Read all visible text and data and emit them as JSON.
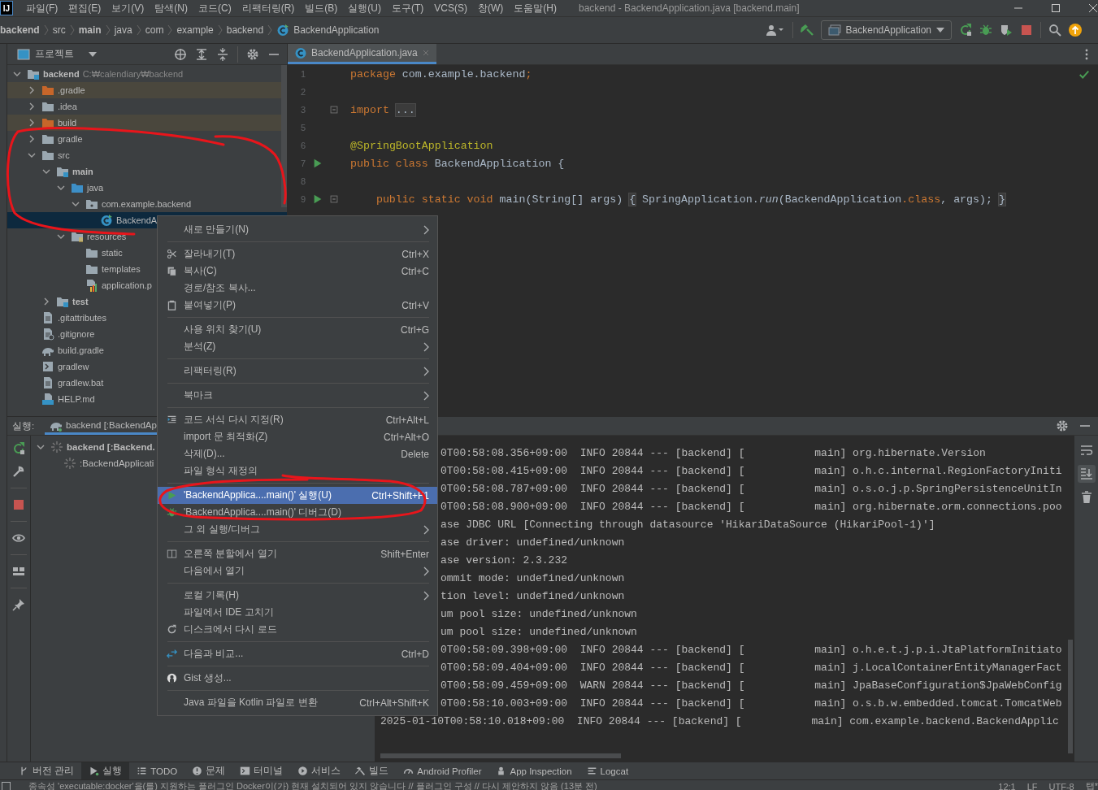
{
  "menu_bar": {
    "logo": "IJ",
    "items": [
      "파일(F)",
      "편집(E)",
      "보기(V)",
      "탐색(N)",
      "코드(C)",
      "리팩터링(R)",
      "빌드(B)",
      "실행(U)",
      "도구(T)",
      "VCS(S)",
      "창(W)",
      "도움말(H)"
    ],
    "title": "backend - BackendApplication.java [backend.main]"
  },
  "breadcrumbs": [
    {
      "label": "backend",
      "kind": "module"
    },
    {
      "label": "src",
      "kind": "folder"
    },
    {
      "label": "main",
      "kind": "module"
    },
    {
      "label": "java",
      "kind": "folder"
    },
    {
      "label": "com",
      "kind": "folder"
    },
    {
      "label": "example",
      "kind": "folder"
    },
    {
      "label": "backend",
      "kind": "folder"
    },
    {
      "label": "BackendApplication",
      "kind": "class"
    }
  ],
  "toolbar": {
    "run_config": "BackendApplication"
  },
  "project_panel": {
    "title": "프로젝트",
    "tree": [
      {
        "label": "backend",
        "kind": "module",
        "hint": "C:₩calendiary₩backend",
        "expanded": true,
        "selected": false,
        "children": [
          {
            "label": ".gradle",
            "kind": "excluded",
            "expanded": false,
            "selected": false
          },
          {
            "label": ".idea",
            "kind": "folder",
            "expanded": false,
            "selected": false
          },
          {
            "label": "build",
            "kind": "excluded",
            "expanded": false,
            "selected": false
          },
          {
            "label": "gradle",
            "kind": "folder",
            "expanded": false,
            "selected": false
          },
          {
            "label": "src",
            "kind": "folder",
            "expanded": true,
            "selected": false,
            "children": [
              {
                "label": "main",
                "kind": "module",
                "expanded": true,
                "selected": false,
                "children": [
                  {
                    "label": "java",
                    "kind": "source",
                    "expanded": true,
                    "selected": false,
                    "children": [
                      {
                        "label": "com.example.backend",
                        "kind": "package",
                        "expanded": true,
                        "selected": false,
                        "children": [
                          {
                            "label": "BackendA",
                            "kind": "class",
                            "selected": true
                          }
                        ]
                      }
                    ]
                  },
                  {
                    "label": "resources",
                    "kind": "resources",
                    "expanded": true,
                    "selected": false,
                    "children": [
                      {
                        "label": "static",
                        "kind": "folder",
                        "selected": false
                      },
                      {
                        "label": "templates",
                        "kind": "folder",
                        "selected": false
                      },
                      {
                        "label": "application.p",
                        "kind": "properties",
                        "selected": false
                      }
                    ]
                  }
                ]
              },
              {
                "label": "test",
                "kind": "module",
                "expanded": false,
                "selected": false
              }
            ]
          },
          {
            "label": ".gitattributes",
            "kind": "text",
            "selected": false
          },
          {
            "label": ".gitignore",
            "kind": "gitignore",
            "selected": false
          },
          {
            "label": "build.gradle",
            "kind": "gradle",
            "selected": false
          },
          {
            "label": "gradlew",
            "kind": "script",
            "selected": false
          },
          {
            "label": "gradlew.bat",
            "kind": "text",
            "selected": false
          },
          {
            "label": "HELP.md",
            "kind": "markdown",
            "selected": false
          }
        ]
      }
    ]
  },
  "editor": {
    "tabs": [
      {
        "label": "BackendApplication.java",
        "selected": true
      }
    ],
    "lines": [
      {
        "number": "1",
        "kind": "top",
        "run_marker": false,
        "fold_marker": false,
        "tokens": [
          {
            "kind": "keyword",
            "text": "package"
          },
          {
            "kind": "plain",
            "text": " com.example.backend"
          },
          {
            "kind": "keyword",
            "text": ";"
          }
        ]
      },
      {
        "number": "2",
        "run_marker": false,
        "fold_marker": false
      },
      {
        "number": "3",
        "kind": "top",
        "run_marker": false,
        "fold_marker": true,
        "tokens": [
          {
            "kind": "keyword",
            "text": "import"
          },
          {
            "kind": "folded",
            "text": "..."
          }
        ]
      },
      {
        "number": "5",
        "run_marker": false,
        "fold_marker": false
      },
      {
        "number": "6",
        "kind": "top",
        "run_marker": false,
        "fold_marker": false,
        "tokens": [
          {
            "kind": "annotation",
            "text": "@SpringBootApplication"
          }
        ]
      },
      {
        "number": "7",
        "kind": "top",
        "run_marker": true,
        "fold_marker": false,
        "tokens": [
          {
            "kind": "keyword",
            "text": "public class"
          },
          {
            "kind": "plain",
            "text": " BackendApplication {"
          }
        ]
      },
      {
        "number": "8",
        "run_marker": false,
        "fold_marker": false
      },
      {
        "number": "9",
        "kind": "member",
        "run_marker": true,
        "fold_marker": true,
        "tokens": [
          {
            "kind": "keyword",
            "text": "public static void"
          },
          {
            "kind": "plain",
            "text": " main(String[] args) "
          },
          {
            "kind": "folded",
            "text": "{"
          },
          {
            "kind": "plain",
            "text": " SpringApplication."
          },
          {
            "kind": "italic",
            "text": "run"
          },
          {
            "kind": "plain",
            "text": "(BackendApplication"
          },
          {
            "kind": "keyword",
            "text": ".class"
          },
          {
            "kind": "plain",
            "text": ", args); "
          },
          {
            "kind": "folded",
            "text": "}"
          }
        ]
      }
    ]
  },
  "context_menu": {
    "items": [
      {
        "kind": "plain",
        "label": "새로 만들기(N)",
        "submenu": true,
        "selected": false
      },
      {
        "kind": "separator"
      },
      {
        "kind": "cut",
        "label": "잘라내기(T)",
        "shortcut": "Ctrl+X",
        "submenu": false,
        "selected": false
      },
      {
        "kind": "copy",
        "label": "복사(C)",
        "shortcut": "Ctrl+C",
        "submenu": false,
        "selected": false
      },
      {
        "kind": "plain",
        "label": "경로/참조 복사...",
        "submenu": false,
        "selected": false
      },
      {
        "kind": "paste",
        "label": "붙여넣기(P)",
        "shortcut": "Ctrl+V",
        "submenu": false,
        "selected": false
      },
      {
        "kind": "separator"
      },
      {
        "kind": "plain",
        "label": "사용 위치 찾기(U)",
        "shortcut": "Ctrl+G",
        "submenu": false,
        "selected": false
      },
      {
        "kind": "plain",
        "label": "분석(Z)",
        "submenu": true,
        "selected": false
      },
      {
        "kind": "separator"
      },
      {
        "kind": "plain",
        "label": "리팩터링(R)",
        "submenu": true,
        "selected": false
      },
      {
        "kind": "separator"
      },
      {
        "kind": "plain",
        "label": "북마크",
        "submenu": true,
        "selected": false
      },
      {
        "kind": "separator"
      },
      {
        "kind": "format",
        "label": "코드 서식 다시 지정(R)",
        "shortcut": "Ctrl+Alt+L",
        "submenu": false,
        "selected": false
      },
      {
        "kind": "plain",
        "label": "import 문 최적화(Z)",
        "shortcut": "Ctrl+Alt+O",
        "submenu": false,
        "selected": false
      },
      {
        "kind": "plain",
        "label": "삭제(D)...",
        "shortcut": "Delete",
        "submenu": false,
        "selected": false
      },
      {
        "kind": "plain",
        "label": "파일 형식 재정의",
        "submenu": false,
        "selected": false
      },
      {
        "kind": "separator"
      },
      {
        "kind": "run",
        "label": "'BackendApplica....main()' 실행(U)",
        "shortcut": "Ctrl+Shift+F1",
        "submenu": false,
        "selected": true
      },
      {
        "kind": "debug",
        "label": "'BackendApplica....main()' 디버그(D)",
        "submenu": false,
        "selected": false
      },
      {
        "kind": "plain",
        "label": "그 외 실행/디버그",
        "submenu": true,
        "selected": false
      },
      {
        "kind": "separator"
      },
      {
        "kind": "split",
        "label": "오른쪽 분할에서 열기",
        "shortcut": "Shift+Enter",
        "submenu": false,
        "selected": false
      },
      {
        "kind": "plain",
        "label": "다음에서 열기",
        "submenu": true,
        "selected": false
      },
      {
        "kind": "separator"
      },
      {
        "kind": "plain",
        "label": "로컬 기록(H)",
        "submenu": true,
        "selected": false
      },
      {
        "kind": "plain",
        "label": "파일에서 IDE 고치기",
        "submenu": false,
        "selected": false
      },
      {
        "kind": "reload",
        "label": "디스크에서 다시 로드",
        "submenu": false,
        "selected": false
      },
      {
        "kind": "separator"
      },
      {
        "kind": "compare",
        "label": "다음과 비교...",
        "shortcut": "Ctrl+D",
        "submenu": false,
        "selected": false
      },
      {
        "kind": "separator"
      },
      {
        "kind": "github",
        "label": "Gist 생성...",
        "submenu": false,
        "selected": false
      },
      {
        "kind": "separator"
      },
      {
        "kind": "plain",
        "label": "Java 파일을 Kotlin 파일로 변환",
        "shortcut": "Ctrl+Alt+Shift+K",
        "submenu": false,
        "selected": false
      }
    ]
  },
  "run_panel": {
    "label": "실행:",
    "tab": "backend [:BackendAp",
    "scroll_to_end_on": true,
    "tree": [
      {
        "label": "backend [:Backend.",
        "expanded": true,
        "children": [
          {
            "label": ":BackendApplicati"
          }
        ]
      }
    ],
    "console": [
      {
        "kind": "partial",
        "text": "0T00:58:08.356+09:00  INFO 20844 --- [backend] [           main] org.hibernate.Version"
      },
      {
        "kind": "partial",
        "text": "0T00:58:08.415+09:00  INFO 20844 --- [backend] [           main] o.h.c.internal.RegionFactoryIniti"
      },
      {
        "kind": "partial",
        "text": "0T00:58:08.787+09:00  INFO 20844 --- [backend] [           main] o.s.o.j.p.SpringPersistenceUnitIn"
      },
      {
        "kind": "partial",
        "text": "0T00:58:08.900+09:00  INFO 20844 --- [backend] [           main] org.hibernate.orm.connections.poo"
      },
      {
        "kind": "partial",
        "text": "ase JDBC URL [Connecting through datasource 'HikariDataSource (HikariPool-1)']"
      },
      {
        "kind": "partial",
        "text": "ase driver: undefined/unknown"
      },
      {
        "kind": "partial",
        "text": "ase version: 2.3.232"
      },
      {
        "kind": "partial",
        "text": "ommit mode: undefined/unknown"
      },
      {
        "kind": "partial",
        "text": "tion level: undefined/unknown"
      },
      {
        "kind": "partial",
        "text": "um pool size: undefined/unknown"
      },
      {
        "kind": "partial",
        "text": "um pool size: undefined/unknown"
      },
      {
        "kind": "partial",
        "text": "0T00:58:09.398+09:00  INFO 20844 --- [backend] [           main] o.h.e.t.j.p.i.JtaPlatformInitiato"
      },
      {
        "kind": "partial",
        "text": "0T00:58:09.404+09:00  INFO 20844 --- [backend] [           main] j.LocalContainerEntityManagerFact"
      },
      {
        "kind": "partial",
        "text": "0T00:58:09.459+09:00  WARN 20844 --- [backend] [           main] JpaBaseConfiguration$JpaWebConfig"
      },
      {
        "kind": "partial",
        "text": "0T00:58:10.003+09:00  INFO 20844 --- [backend] [           main] o.s.b.w.embedded.tomcat.TomcatWeb"
      },
      {
        "kind": "full",
        "text": "2025-01-10T00:58:10.018+09:00  INFO 20844 --- [backend] [           main] com.example.backend.BackendApplic"
      }
    ]
  },
  "tool_tabs": [
    {
      "label": "버전 관리",
      "kind": "vcs",
      "selected": false
    },
    {
      "label": "실행",
      "kind": "run",
      "selected": true
    },
    {
      "label": "TODO",
      "kind": "todo",
      "selected": false
    },
    {
      "label": "문제",
      "kind": "problems",
      "selected": false
    },
    {
      "label": "터미널",
      "kind": "terminal",
      "selected": false
    },
    {
      "label": "서비스",
      "kind": "services",
      "selected": false
    },
    {
      "label": "빌드",
      "kind": "build",
      "selected": false
    },
    {
      "label": "Android Profiler",
      "kind": "profiler",
      "selected": false
    },
    {
      "label": "App Inspection",
      "kind": "inspection",
      "selected": false
    },
    {
      "label": "Logcat",
      "kind": "logcat",
      "selected": false
    }
  ],
  "status_bar": {
    "message": "종속성 'executable:docker'을(를) 지원하는 플러그인 Docker이(가) 현재 설치되어 있지 않습니다 // 플러그인 구성    // 다시 제안하지 않음 (13분 전)",
    "position": "12:1",
    "line_separator": "LF",
    "encoding": "UTF-8",
    "indent": "탭*"
  }
}
